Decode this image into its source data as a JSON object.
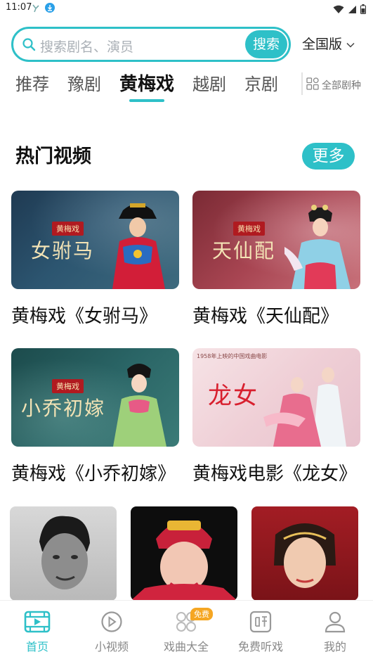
{
  "status_bar": {
    "time": "11:07"
  },
  "search": {
    "placeholder": "搜索剧名、演员",
    "button_label": "搜索",
    "region_label": "全国版"
  },
  "tabs": [
    {
      "label": "推荐",
      "active": false
    },
    {
      "label": "豫剧",
      "active": false
    },
    {
      "label": "黄梅戏",
      "active": true
    },
    {
      "label": "越剧",
      "active": false
    },
    {
      "label": "京剧",
      "active": false
    }
  ],
  "all_types_label": "全部剧种",
  "section": {
    "title": "热门视频",
    "more_label": "更多"
  },
  "videos": [
    {
      "title": "黄梅戏《女驸马》",
      "badge": "黄梅戏",
      "art_text": "女驸马"
    },
    {
      "title": "黄梅戏《天仙配》",
      "badge": "黄梅戏",
      "art_text": "天仙配"
    },
    {
      "title": "黄梅戏《小乔初嫁》",
      "badge": "黄梅戏",
      "art_text": "小乔初嫁"
    },
    {
      "title": "黄梅戏电影《龙女》",
      "badge": "",
      "art_text": "龙女"
    }
  ],
  "video4_caption": "1958年上映的中国戏曲电影",
  "bottom_nav": {
    "items": [
      {
        "label": "首页",
        "icon": "film-icon",
        "active": true
      },
      {
        "label": "小视频",
        "icon": "play-circle-icon",
        "active": false
      },
      {
        "label": "戏曲大全",
        "icon": "grid-icon",
        "active": false,
        "badge": "免费"
      },
      {
        "label": "免费听戏",
        "icon": "listen-icon",
        "active": false
      },
      {
        "label": "我的",
        "icon": "user-icon",
        "active": false
      }
    ]
  },
  "colors": {
    "accent": "#2ec0c8",
    "badge_orange": "#f5a623"
  }
}
